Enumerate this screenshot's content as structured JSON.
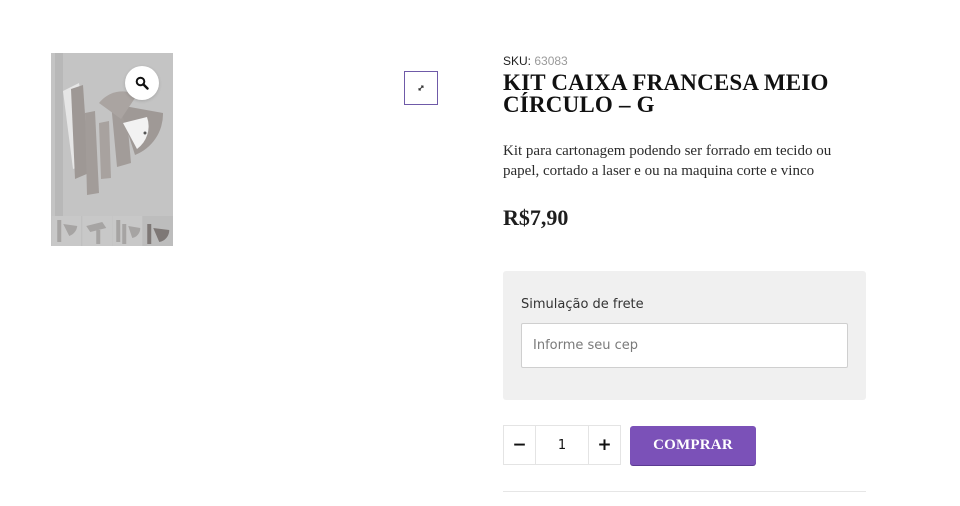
{
  "product": {
    "sku_label": "SKU:",
    "sku_value": "63083",
    "title": "KIT CAIXA FRANCESA MEIO CÍRCULO – G",
    "description": "Kit para cartonagem podendo ser forrado em tecido ou papel, cortado a laser e ou na maquina corte e vinco",
    "price": "R$7,90"
  },
  "gallery": {
    "zoom_icon": "magnifier-icon",
    "expand_icon": "expand-icon",
    "thumbnail_count": 4
  },
  "shipping": {
    "label": "Simulação de frete",
    "cep_placeholder": "Informe seu cep",
    "cep_value": ""
  },
  "cart": {
    "minus_label": "−",
    "plus_label": "+",
    "quantity": "1",
    "buy_label": "COMPRAR"
  },
  "colors": {
    "accent": "#7b51b8",
    "expand_border": "#6f5aa8",
    "shipping_bg": "#f0f0f0"
  }
}
